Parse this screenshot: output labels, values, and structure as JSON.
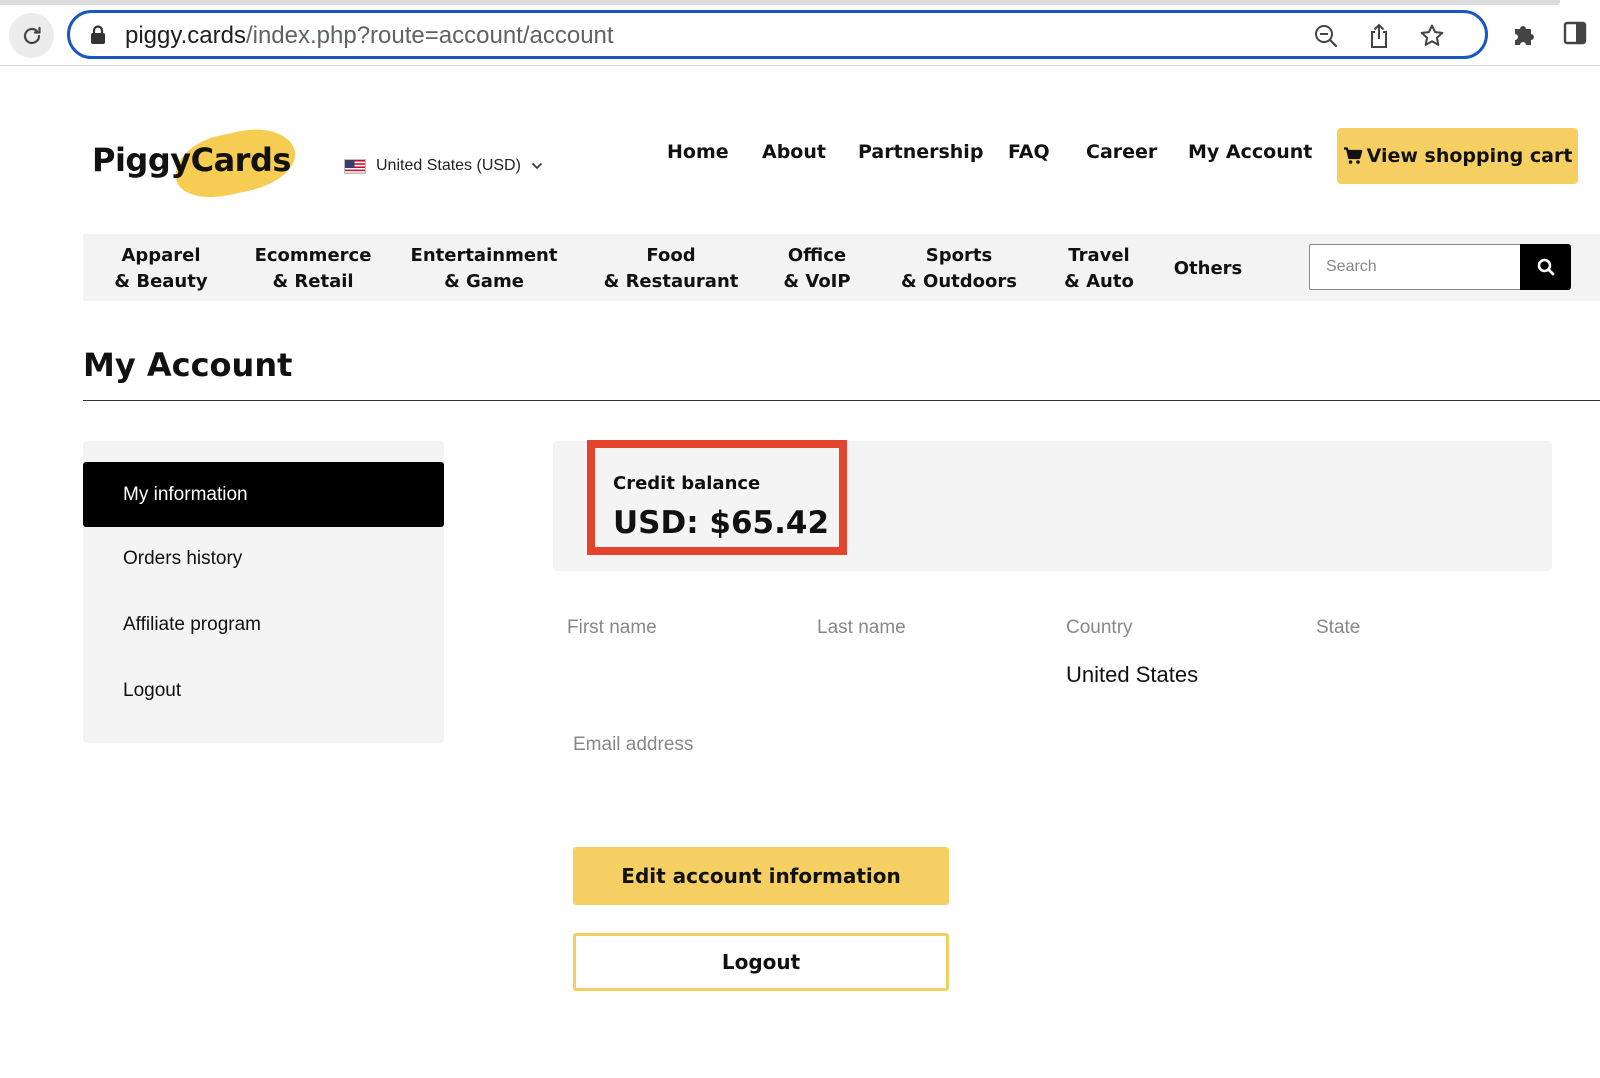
{
  "browser": {
    "url_host": "piggy.cards",
    "url_path": "/index.php?route=account/account"
  },
  "header": {
    "logo_text": "PiggyCards",
    "region": "United States (USD)",
    "nav": [
      "Home",
      "About",
      "Partnership",
      "FAQ",
      "Career",
      "My Account"
    ],
    "cart_label": "View shopping cart"
  },
  "categories": [
    "Apparel\n& Beauty",
    "Ecommerce\n& Retail",
    "Entertainment\n& Game",
    "Food\n& Restaurant",
    "Office\n& VoIP",
    "Sports\n& Outdoors",
    "Travel\n& Auto",
    "Others"
  ],
  "search": {
    "placeholder": "Search"
  },
  "page": {
    "title": "My Account"
  },
  "sidebar": {
    "items": [
      {
        "label": "My information",
        "active": true
      },
      {
        "label": "Orders history",
        "active": false
      },
      {
        "label": "Affiliate program",
        "active": false
      },
      {
        "label": "Logout",
        "active": false
      }
    ]
  },
  "balance": {
    "label": "Credit balance",
    "value": "USD: $65.42"
  },
  "fields": {
    "first_name_label": "First name",
    "last_name_label": "Last name",
    "country_label": "Country",
    "country_value": "United States",
    "state_label": "State",
    "email_label": "Email address"
  },
  "actions": {
    "edit_label": "Edit account information",
    "logout_label": "Logout"
  },
  "colors": {
    "accent_yellow": "#f6cf63",
    "highlight_red": "#e4432d",
    "active_black": "#000000"
  }
}
